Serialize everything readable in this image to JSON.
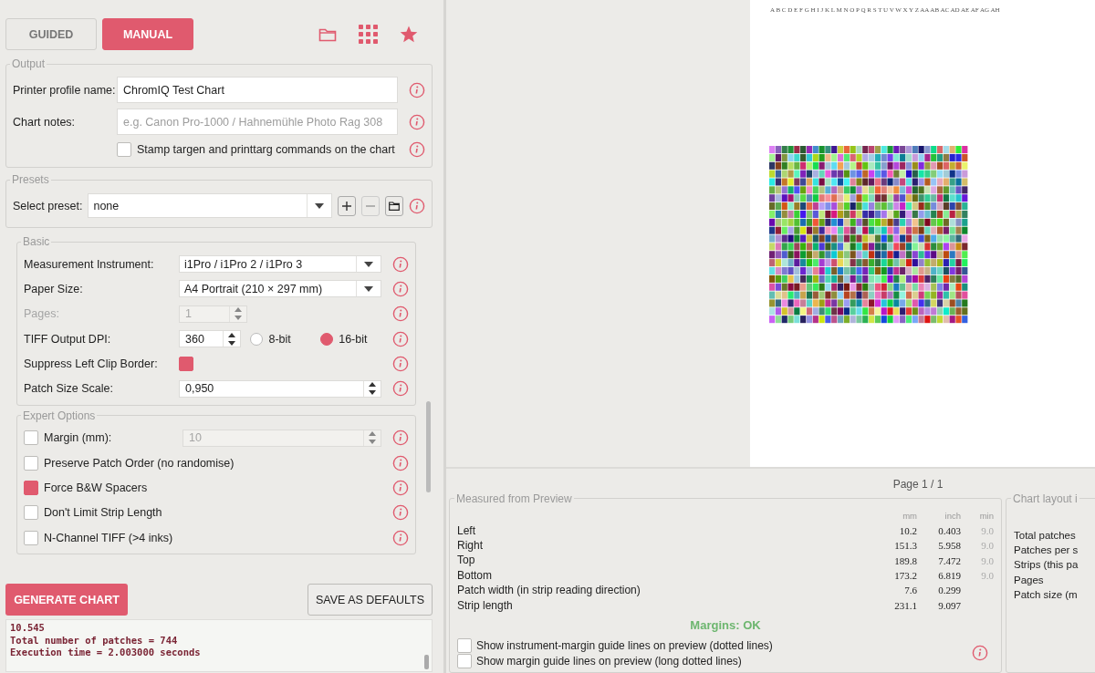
{
  "mode_tabs": [
    {
      "label": "GUIDED",
      "selected": false
    },
    {
      "label": "MANUAL",
      "selected": true
    }
  ],
  "output": {
    "legend": "Output",
    "fields": [
      {
        "label": "Printer profile name:",
        "value": "ChromIQ Test Chart"
      },
      {
        "label": "Chart notes:",
        "placeholder": "e.g. Canon Pro-1000 / Hahnemühle Photo Rag 308"
      }
    ],
    "stamp": {
      "label": "Stamp targen and printtarg commands on the chart",
      "checked": false
    }
  },
  "presets": {
    "legend": "Presets",
    "label": "Select preset:",
    "value": "none"
  },
  "basic": {
    "legend": "Basic",
    "rows": [
      {
        "kind": "select",
        "label": "Measurement Instrument:",
        "value": "i1Pro / i1Pro 2 / i1Pro 3",
        "disabled": false
      },
      {
        "kind": "select",
        "label": "Paper Size:",
        "value": "A4 Portrait (210 × 297 mm)",
        "disabled": false
      },
      {
        "kind": "spin",
        "label": "Pages:",
        "value": "1",
        "disabled": true
      },
      {
        "kind": "dpi",
        "label": "TIFF Output DPI:",
        "value": "360",
        "disabled": false,
        "options": [
          {
            "label": "8-bit",
            "selected": false
          },
          {
            "label": "16-bit",
            "selected": true
          }
        ]
      },
      {
        "kind": "check",
        "label": "Suppress Left Clip Border:",
        "checked": true,
        "disabled": false
      },
      {
        "kind": "wide-spin",
        "label": "Patch Size Scale:",
        "value": "0,950",
        "disabled": false
      }
    ]
  },
  "expert": {
    "legend": "Expert Options",
    "rows": [
      {
        "kind": "check-spin",
        "label": "Margin (mm):",
        "checked": false,
        "value": "10"
      },
      {
        "kind": "check",
        "label": "Preserve Patch Order (no randomise)",
        "checked": false
      },
      {
        "kind": "check",
        "label": "Force B&W Spacers",
        "checked": true
      },
      {
        "kind": "check",
        "label": "Don't Limit Strip Length",
        "checked": false
      },
      {
        "kind": "check",
        "label": "N-Channel TIFF (>4 inks)",
        "checked": false
      }
    ]
  },
  "buttons": {
    "generate": "GENERATE CHART",
    "save": "SAVE AS DEFAULTS"
  },
  "log": [
    "10.545",
    "Total number of patches = 744",
    "Execution time = 2.003000 seconds"
  ],
  "preview": {
    "column_letters": "A B C D E F G H I J K L M N O P Q R S T U V W X Y Z AA AB AC AD AE AF AG AH",
    "page_label": "Page 1 / 1"
  },
  "measured": {
    "legend": "Measured from Preview",
    "columns": [
      "mm",
      "inch",
      "min"
    ],
    "rows": [
      {
        "label": "Left",
        "mm": "10.2",
        "inch": "0.403",
        "min": "9.0"
      },
      {
        "label": "Right",
        "mm": "151.3",
        "inch": "5.958",
        "min": "9.0"
      },
      {
        "label": "Top",
        "mm": "189.8",
        "inch": "7.472",
        "min": "9.0"
      },
      {
        "label": "Bottom",
        "mm": "173.2",
        "inch": "6.819",
        "min": "9.0"
      },
      {
        "label": "Patch width (in strip reading direction)",
        "mm": "7.6",
        "inch": "0.299"
      },
      {
        "label": "Strip length",
        "mm": "231.1",
        "inch": "9.097"
      }
    ],
    "status": "Margins: OK",
    "options": [
      {
        "label": "Show instrument-margin guide lines on preview (dotted lines)",
        "checked": false
      },
      {
        "label": "Show margin guide lines on preview (long dotted lines)",
        "checked": false
      }
    ]
  },
  "layout": {
    "legend": "Chart layout i",
    "rows": [
      "Total patches",
      "Patches per s",
      "Strips (this pa",
      "Pages",
      "Patch size (m"
    ]
  }
}
